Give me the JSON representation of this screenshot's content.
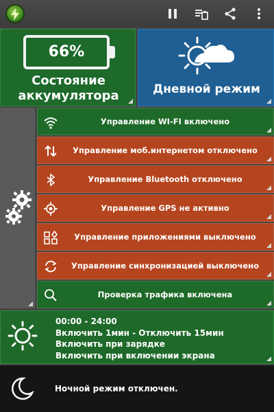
{
  "toolbar": {
    "icons": [
      "app-logo-icon",
      "pause-icon",
      "battery-list-icon",
      "share-icon",
      "more-vert-icon"
    ]
  },
  "battery": {
    "percent": "66%",
    "label_line1": "Состояние",
    "label_line2": "аккумулятора"
  },
  "mode": {
    "label": "Дневной режим"
  },
  "controls": [
    {
      "icon": "wifi-icon",
      "label": "Управление WI-FI включено",
      "status_color": "#1e6a28"
    },
    {
      "icon": "mobile-data-icon",
      "label": "Управление моб.интернетом отключено",
      "status_color": "#b4451e"
    },
    {
      "icon": "bluetooth-icon",
      "label": "Управление Bluetooth отключено",
      "status_color": "#b4451e"
    },
    {
      "icon": "gps-icon",
      "label": "Управление GPS не активно",
      "status_color": "#b4451e"
    },
    {
      "icon": "apps-icon",
      "label": "Управление приложениями выключено",
      "status_color": "#b4451e"
    },
    {
      "icon": "sync-icon",
      "label": "Управление синхронизацией выключено",
      "status_color": "#b4451e"
    },
    {
      "icon": "search-icon",
      "label": "Проверка трафика включена",
      "status_color": "#1e6a28"
    }
  ],
  "schedule": {
    "lines": [
      "00:00 - 24:00",
      "Включить 1мин - Отключить 15мин",
      "Включить при зарядке",
      "Включить при включении экрана"
    ]
  },
  "night": {
    "label": "Ночной режим отключен."
  },
  "colors": {
    "green": "#1e6a28",
    "orange": "#b4451e",
    "blue": "#1f5f93",
    "dark": "#151515"
  }
}
